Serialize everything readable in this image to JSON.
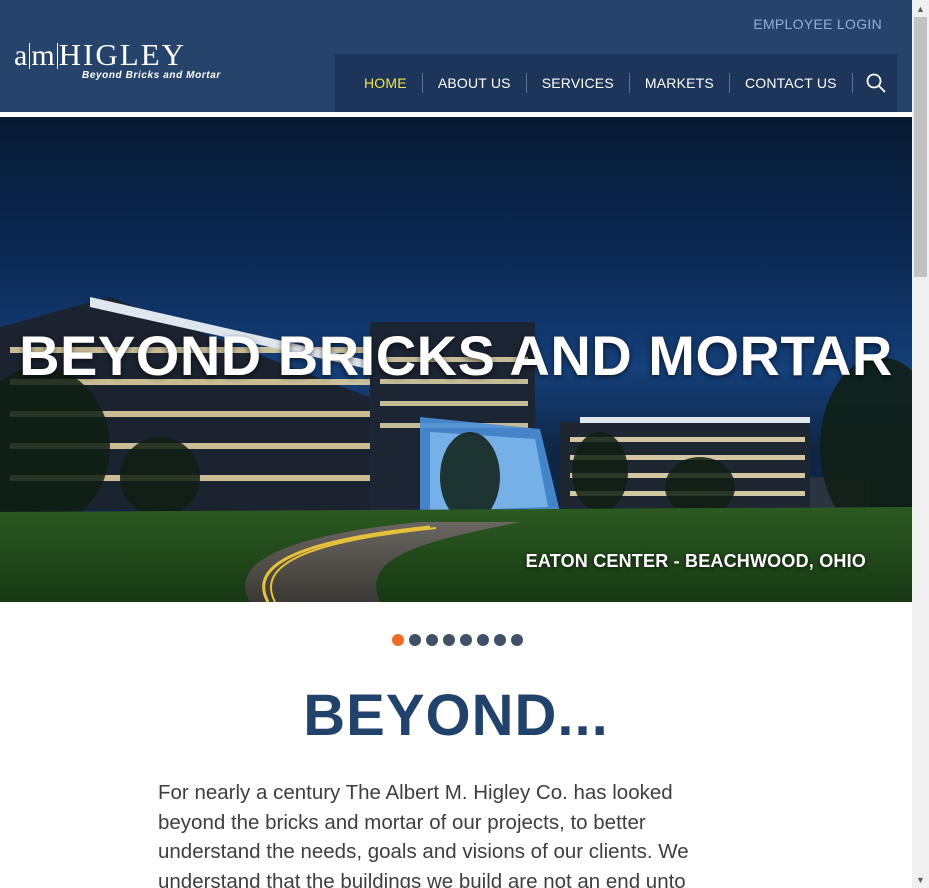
{
  "header": {
    "logo_main_left": "a",
    "logo_main_mid": "m",
    "logo_main_right": "HIGLEY",
    "logo_tagline": "Beyond Bricks and Mortar",
    "employee_login": "EMPLOYEE LOGIN",
    "nav": [
      {
        "label": "HOME",
        "active": true
      },
      {
        "label": "ABOUT US",
        "active": false
      },
      {
        "label": "SERVICES",
        "active": false
      },
      {
        "label": "MARKETS",
        "active": false
      },
      {
        "label": "CONTACT US",
        "active": false
      }
    ],
    "search_icon": "search-icon"
  },
  "hero": {
    "title": "BEYOND BRICKS AND MORTAR",
    "caption": "EATON CENTER - BEACHWOOD, OHIO"
  },
  "slider": {
    "count": 8,
    "active_index": 0
  },
  "content": {
    "heading": "BEYOND...",
    "intro": "For nearly a century The Albert M. Higley Co. has looked beyond the bricks and mortar of our projects, to better understand the needs, goals and visions of our clients. We understand that the buildings we build are not an end unto"
  },
  "colors": {
    "header_bg": "#26436b",
    "nav_bg": "#1c3558",
    "nav_active": "#f3e24a",
    "heading": "#21426b",
    "dot_active": "#ef6a2a",
    "dot_inactive": "#3f5068"
  }
}
